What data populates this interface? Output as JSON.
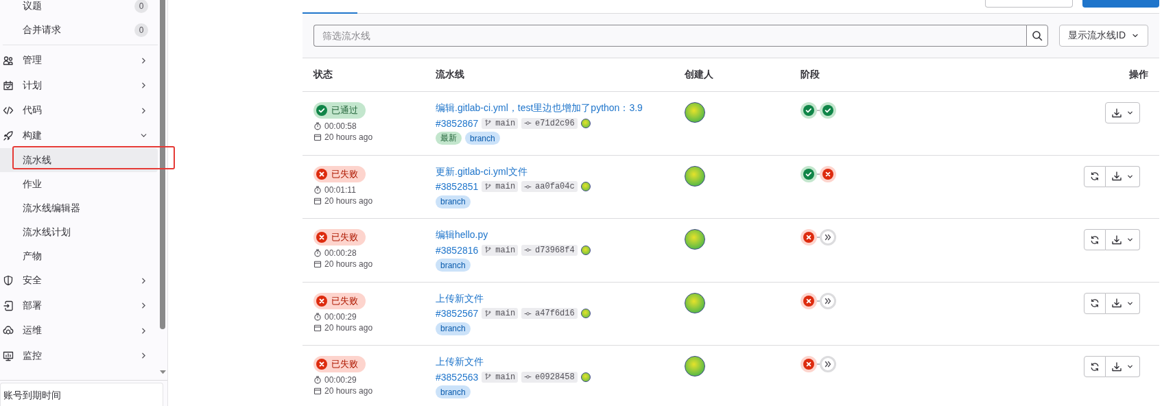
{
  "sidebar": {
    "pinned": [
      {
        "label": "议题",
        "count": "0"
      },
      {
        "label": "合并请求",
        "count": "0"
      }
    ],
    "sections": [
      {
        "label": "管理",
        "expanded": false
      },
      {
        "label": "计划",
        "expanded": false
      },
      {
        "label": "代码",
        "expanded": false
      },
      {
        "label": "构建",
        "expanded": true,
        "children": [
          {
            "label": "流水线",
            "selected": true
          },
          {
            "label": "作业",
            "selected": false
          },
          {
            "label": "流水线编辑器",
            "selected": false
          },
          {
            "label": "流水线计划",
            "selected": false
          },
          {
            "label": "产物",
            "selected": false
          }
        ]
      },
      {
        "label": "安全",
        "expanded": false
      },
      {
        "label": "部署",
        "expanded": false
      },
      {
        "label": "运维",
        "expanded": false
      },
      {
        "label": "监控",
        "expanded": false
      }
    ],
    "footer": "账号到期时间"
  },
  "filter": {
    "placeholder": "筛选流水线",
    "display_dropdown": "显示流水线ID"
  },
  "table": {
    "columns": [
      "状态",
      "流水线",
      "创建人",
      "阶段",
      "操作"
    ],
    "rows": [
      {
        "status": {
          "kind": "passed",
          "label": "已通过"
        },
        "duration": "00:00:58",
        "time": "20 hours ago",
        "title": "编辑.gitlab-ci.yml，test里边也增加了python：3.9",
        "id": "#3852867",
        "branch": "main",
        "commit": "e71d2c96",
        "tags": [
          {
            "kind": "latest",
            "label": "最新"
          },
          {
            "kind": "branch",
            "label": "branch"
          }
        ],
        "stages": [
          {
            "kind": "success"
          },
          {
            "kind": "success"
          }
        ],
        "retry": false
      },
      {
        "status": {
          "kind": "failed",
          "label": "已失败"
        },
        "duration": "00:01:11",
        "time": "20 hours ago",
        "title": "更新.gitlab-ci.yml文件",
        "id": "#3852851",
        "branch": "main",
        "commit": "aa0fa04c",
        "tags": [
          {
            "kind": "branch",
            "label": "branch"
          }
        ],
        "stages": [
          {
            "kind": "success"
          },
          {
            "kind": "failed"
          }
        ],
        "retry": true
      },
      {
        "status": {
          "kind": "failed",
          "label": "已失败"
        },
        "duration": "00:00:28",
        "time": "20 hours ago",
        "title": "编辑hello.py",
        "id": "#3852816",
        "branch": "main",
        "commit": "d73968f4",
        "tags": [
          {
            "kind": "branch",
            "label": "branch"
          }
        ],
        "stages": [
          {
            "kind": "failed"
          },
          {
            "kind": "skipped"
          }
        ],
        "retry": true
      },
      {
        "status": {
          "kind": "failed",
          "label": "已失败"
        },
        "duration": "00:00:29",
        "time": "20 hours ago",
        "title": "上传新文件",
        "id": "#3852567",
        "branch": "main",
        "commit": "a47f6d16",
        "tags": [
          {
            "kind": "branch",
            "label": "branch"
          }
        ],
        "stages": [
          {
            "kind": "failed"
          },
          {
            "kind": "skipped"
          }
        ],
        "retry": true
      },
      {
        "status": {
          "kind": "failed",
          "label": "已失败"
        },
        "duration": "00:00:29",
        "time": "20 hours ago",
        "title": "上传新文件",
        "id": "#3852563",
        "branch": "main",
        "commit": "e0928458",
        "tags": [
          {
            "kind": "branch",
            "label": "branch"
          }
        ],
        "stages": [
          {
            "kind": "failed"
          },
          {
            "kind": "skipped"
          }
        ],
        "retry": true
      }
    ]
  }
}
